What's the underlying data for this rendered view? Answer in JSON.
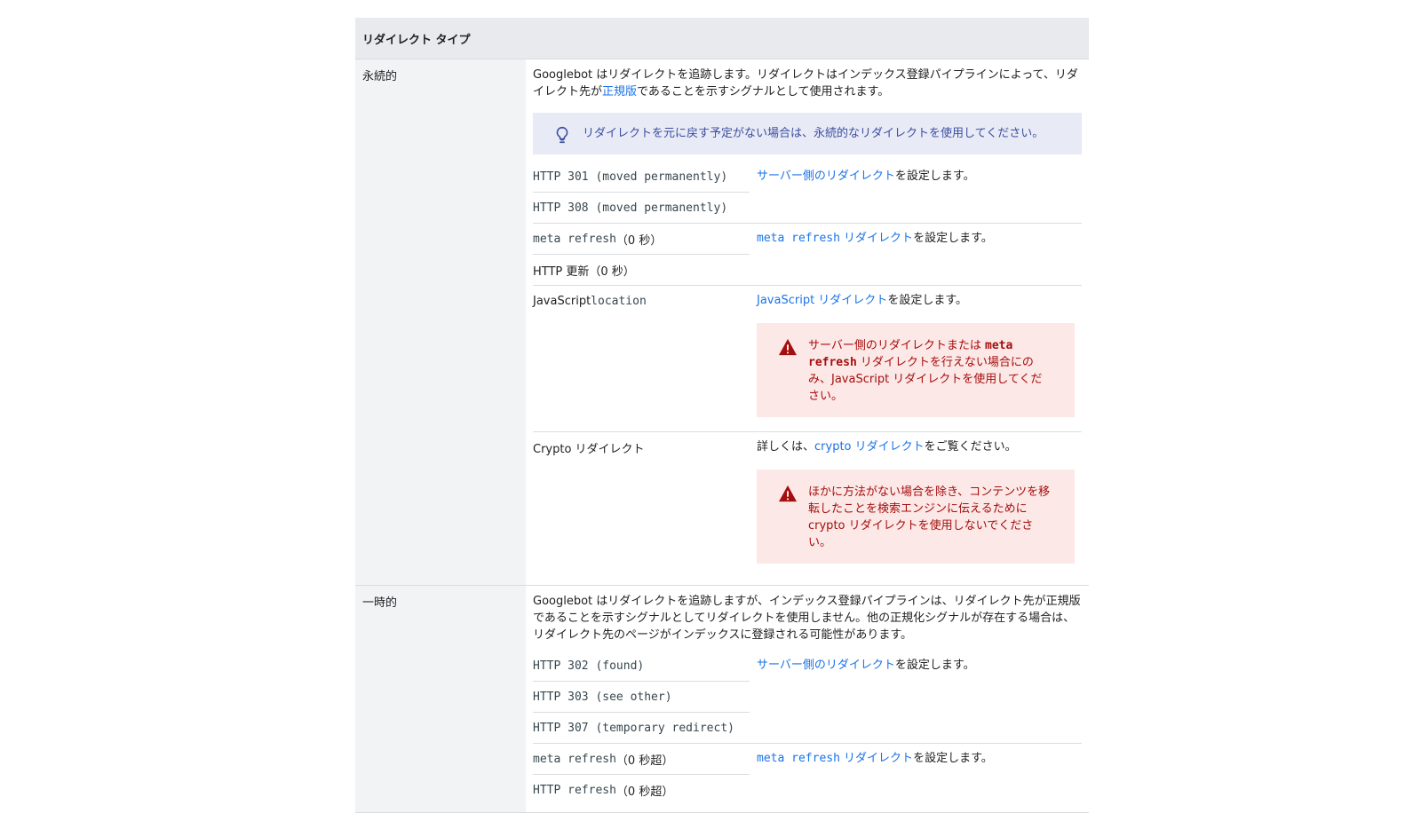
{
  "table": {
    "header": "リダイレクト タイプ",
    "permanent": {
      "label": "永続的",
      "desc_before": "Googlebot はリダイレクトを追跡します。リダイレクトはインデックス登録パイプラインによって、リダイレクト先が",
      "desc_link": "正規版",
      "desc_after": "であることを示すシグナルとして使用されます。",
      "note": "リダイレクトを元に戻す予定がない場合は、永続的なリダイレクトを使用してください。",
      "groups": [
        {
          "items": [
            "HTTP 301 (moved permanently)",
            "HTTP 308 (moved permanently)"
          ],
          "action_link": "サーバー側のリダイレクト",
          "action_text": "を設定します。"
        },
        {
          "item1_code": "meta refresh",
          "item1_text": "（0 秒）",
          "item2": "HTTP 更新（0 秒）",
          "action_link_code": "meta refresh",
          "action_link": " リダイレクト",
          "action_text": "を設定します。"
        },
        {
          "item_text": "JavaScript ",
          "item_code": "location",
          "action_link": "JavaScript リダイレクト",
          "action_text": "を設定します。",
          "warning_before": "サーバー側のリダイレクトまたは ",
          "warning_code": "meta refresh",
          "warning_after": " リダイレクトを行えない場合にのみ、JavaScript リダイレクトを使用してください。"
        },
        {
          "item": "Crypto リダイレクト",
          "action_before": "詳しくは、",
          "action_link": "crypto リダイレクト",
          "action_text": "をご覧ください。",
          "warning": "ほかに方法がない場合を除き、コンテンツを移転したことを検索エンジンに伝えるために crypto リダイレクトを使用しないでください。"
        }
      ]
    },
    "temporary": {
      "label": "一時的",
      "desc": "Googlebot はリダイレクトを追跡しますが、インデックス登録パイプラインは、リダイレクト先が正規版であることを示すシグナルとしてリダイレクトを使用しません。他の正規化シグナルが存在する場合は、リダイレクト先のページがインデックスに登録される可能性があります。",
      "groups": [
        {
          "items": [
            "HTTP 302 (found)",
            "HTTP 303 (see other)",
            "HTTP 307 (temporary redirect)"
          ],
          "action_link": "サーバー側のリダイレクト",
          "action_text": "を設定します。"
        },
        {
          "item1_code": "meta refresh",
          "item1_text": "（0 秒超）",
          "item2_code": "HTTP refresh",
          "item2_text": "（0 秒超）",
          "action_link_code": "meta refresh",
          "action_link": " リダイレクト",
          "action_text": "を設定します。"
        }
      ]
    }
  },
  "colors": {
    "link": "#1a73e8",
    "note_bg": "#e8eaf6",
    "warning_bg": "#fce8e6",
    "warning_text": "#a50e0e",
    "header_bg": "#e8eaed"
  },
  "icons": [
    "lightbulb-icon",
    "warning-icon"
  ]
}
